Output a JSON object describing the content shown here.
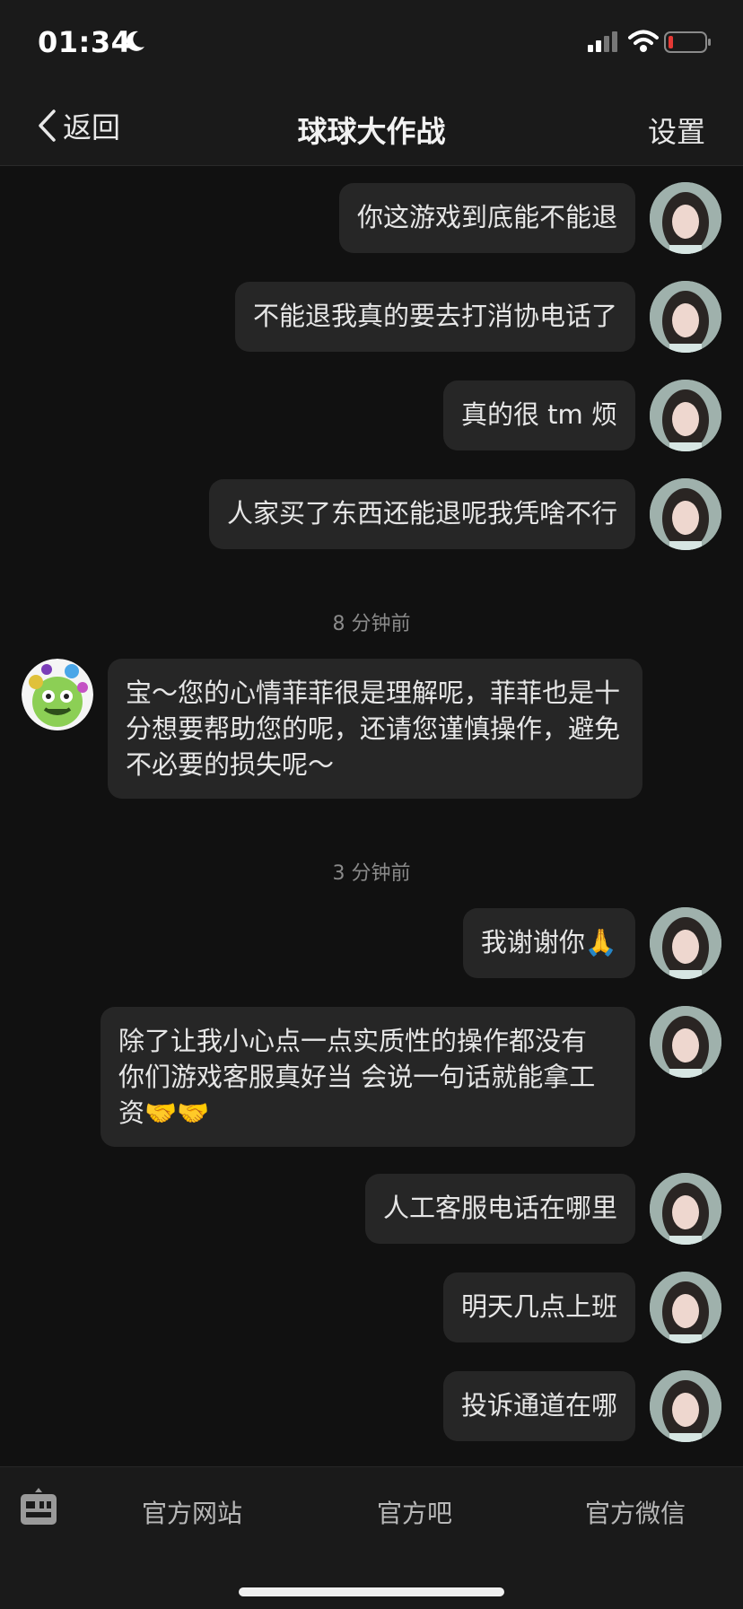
{
  "status": {
    "time": "01:34"
  },
  "nav": {
    "back_label": "返回",
    "title": "球球大作战",
    "settings_label": "设置"
  },
  "messages": {
    "m1": "你这游戏到底能不能退",
    "m2": "不能退我真的要去打消协电话了",
    "m3": "真的很 tm 烦",
    "m4": "人家买了东西还能退呢我凭啥不行",
    "t1": "8 分钟前",
    "r1": "宝～您的心情菲菲很是理解呢，菲菲也是十分想要帮助您的呢，还请您谨慎操作，避免不必要的损失呢～",
    "t2": "3 分钟前",
    "m5": "我谢谢你🙏",
    "m6": "除了让我小心点一点实质性的操作都没有 你们游戏客服真好当 会说一句话就能拿工资🤝🤝",
    "m7": "人工客服电话在哪里",
    "m8": "明天几点上班",
    "m9": "投诉通道在哪"
  },
  "bottom": {
    "tab1": "官方网站",
    "tab2": "官方吧",
    "tab3": "官方微信"
  },
  "colors": {
    "background": "#111111",
    "bubble": "#262626",
    "bar": "#1a1a1a",
    "battery_low": "#e53935"
  },
  "icons": {
    "keyboard": "keyboard-icon",
    "back": "chevron-left-icon"
  }
}
